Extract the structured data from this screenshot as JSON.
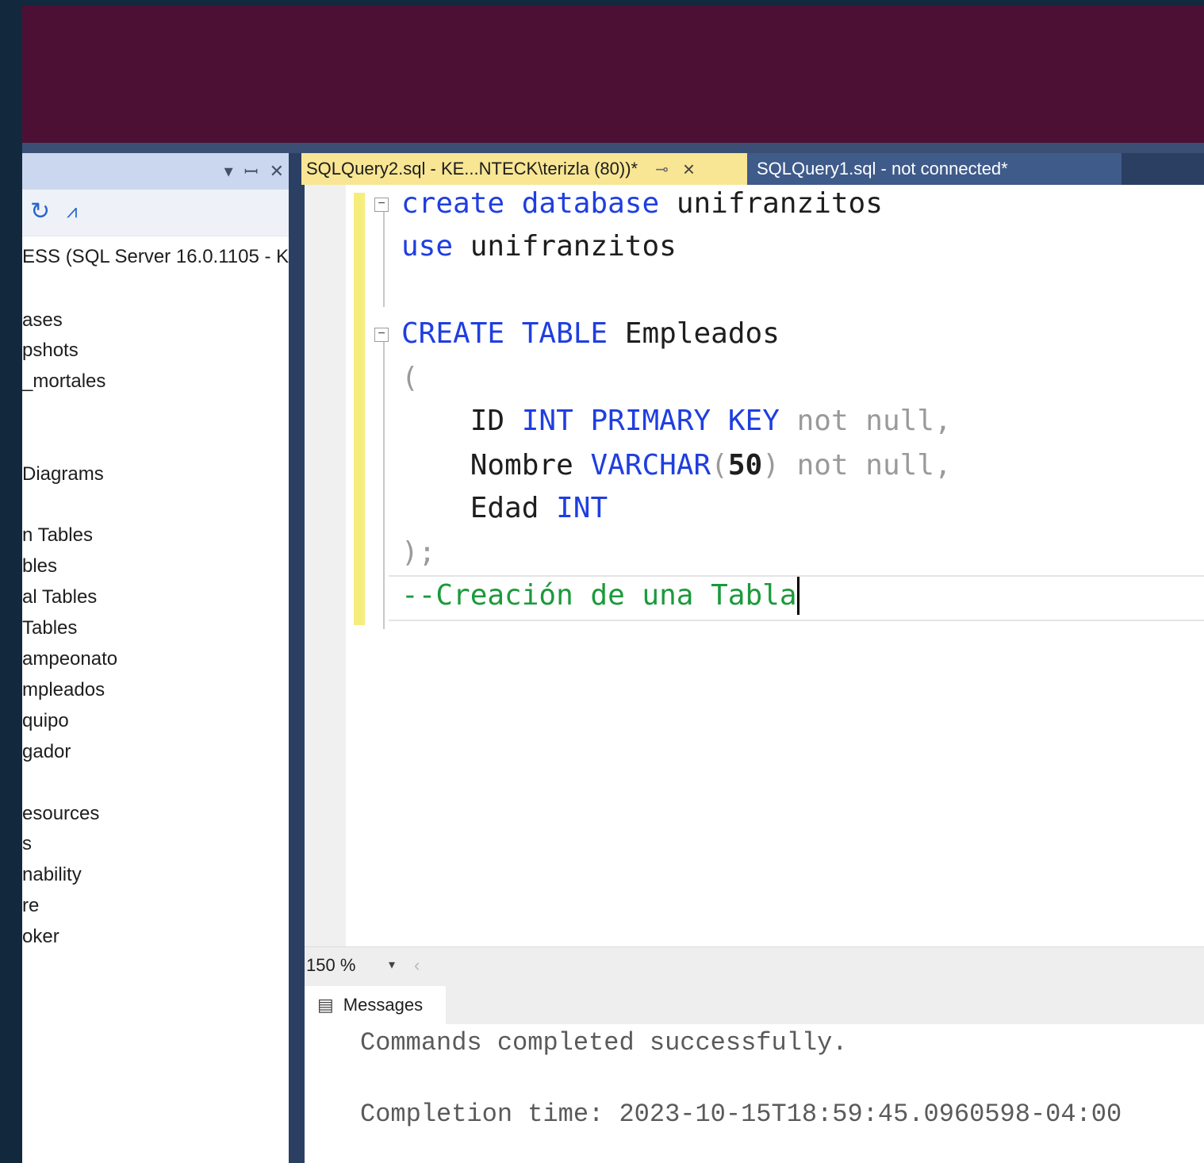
{
  "colors": {
    "background": "#12283d",
    "title_band": "#4b1034",
    "active_tab": "#f8e694",
    "inactive_tab": "#3f5b8a",
    "keyword": "#1f3ee0",
    "comment": "#1b9a3b"
  },
  "object_explorer": {
    "title_buttons": [
      "▾",
      "ꟷ",
      "✕"
    ],
    "toolbar_icons": [
      "refresh-icon",
      "activity-monitor-icon"
    ],
    "server": "ESS (SQL Server 16.0.1105 - K",
    "nodes": [
      "ases",
      "pshots",
      "_mortales",
      "Diagrams",
      "n Tables",
      "bles",
      "al Tables",
      " Tables",
      "ampeonato",
      "mpleados",
      "quipo",
      "gador",
      "esources",
      "s",
      "nability",
      "re",
      "oker"
    ]
  },
  "tabs": {
    "active": "SQLQuery2.sql - KE...NTECK\\terizla (80))*",
    "inactive": "SQLQuery1.sql - not connected*"
  },
  "editor": {
    "line1": {
      "kw1": "create",
      "kw2": "database",
      "name": "unifranzitos"
    },
    "line2": {
      "kw": "use",
      "name": "unifranzitos"
    },
    "line3": {
      "kw1": "CREATE",
      "kw2": "TABLE",
      "name": "Empleados"
    },
    "line4": {
      "paren": "("
    },
    "line5": {
      "col": "ID",
      "type": "INT",
      "pk1": "PRIMARY",
      "pk2": "KEY",
      "rest": "not null,"
    },
    "line6": {
      "col": "Nombre",
      "type": "VARCHAR",
      "open": "(",
      "len": "50",
      "close": ")",
      "rest": "not null,"
    },
    "line7": {
      "col": "Edad",
      "type": "INT"
    },
    "line8": {
      "close": ");"
    },
    "line9": {
      "comment": "--Creación de una Tabla"
    }
  },
  "zoom": {
    "value": "150 %"
  },
  "results": {
    "tab_label": "Messages",
    "line1": "Commands completed successfully.",
    "line2": "Completion time: 2023-10-15T18:59:45.0960598-04:00"
  }
}
